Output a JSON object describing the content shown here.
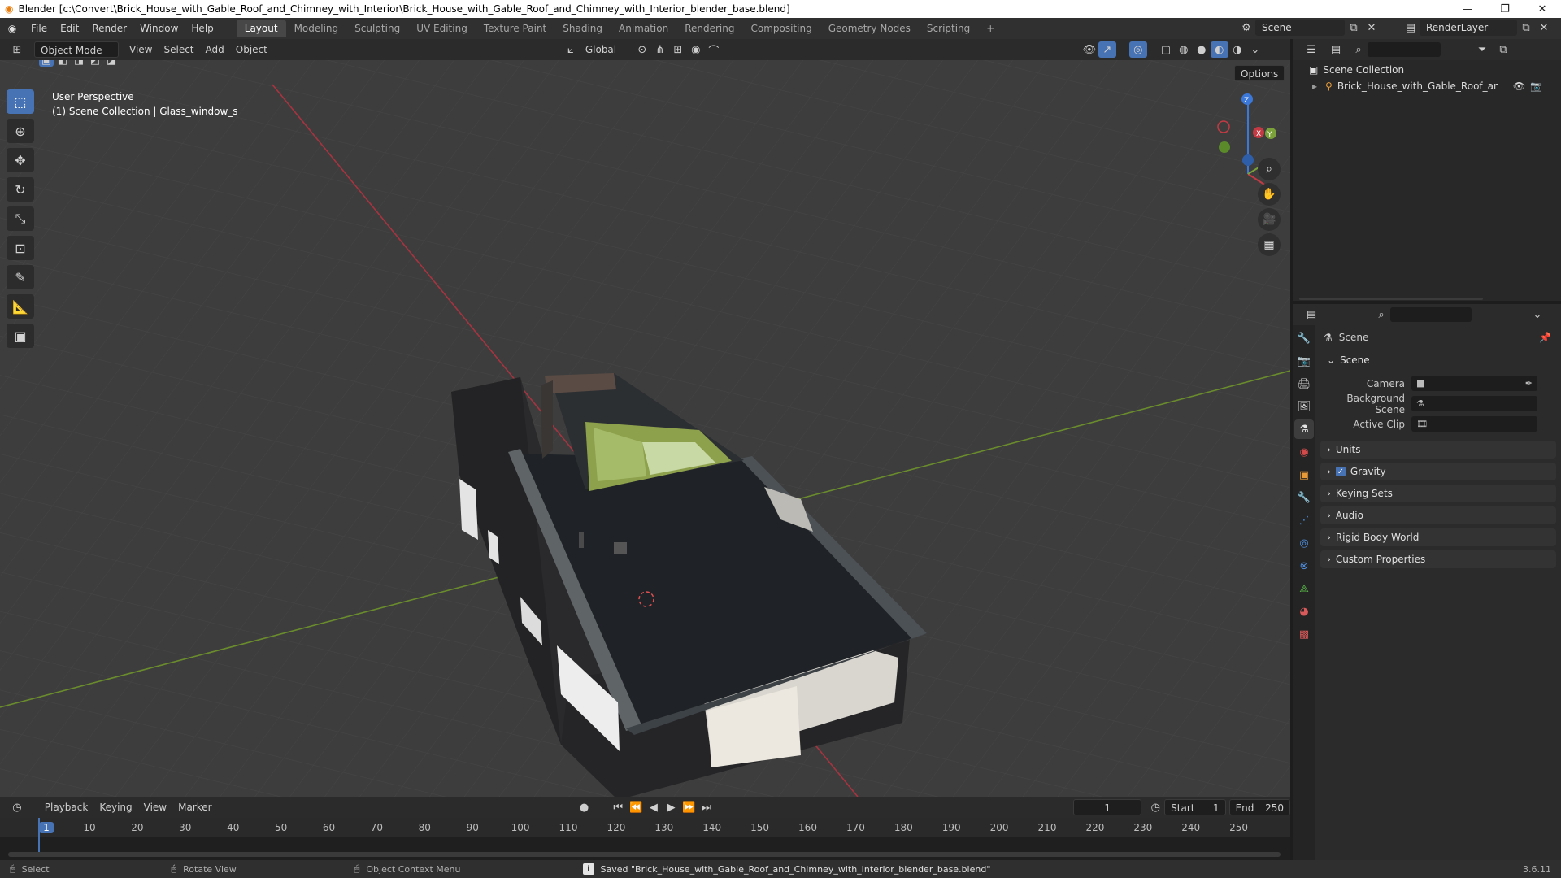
{
  "window": {
    "title": "Blender [c:\\Convert\\Brick_House_with_Gable_Roof_and_Chimney_with_Interior\\Brick_House_with_Gable_Roof_and_Chimney_with_Interior_blender_base.blend]",
    "minimize": "—",
    "maximize": "❐",
    "close": "✕"
  },
  "menu": {
    "items": [
      "File",
      "Edit",
      "Render",
      "Window",
      "Help"
    ],
    "workspaces": [
      "Layout",
      "Modeling",
      "Sculpting",
      "UV Editing",
      "Texture Paint",
      "Shading",
      "Animation",
      "Rendering",
      "Compositing",
      "Geometry Nodes",
      "Scripting"
    ],
    "active_workspace": "Layout",
    "add_tab": "+",
    "scene_name": "Scene",
    "view_layer": "RenderLayer"
  },
  "viewport_header": {
    "mode": "Object Mode",
    "menus": [
      "View",
      "Select",
      "Add",
      "Object"
    ],
    "orientation": "Global",
    "options": "Options"
  },
  "viewport": {
    "perspective": "User Perspective",
    "collection_info": "(1) Scene Collection | Glass_window_s",
    "gizmo_axes": [
      "X",
      "Y",
      "Z"
    ],
    "colors": {
      "x_axis": "#c33a44",
      "y_axis": "#7aa13a",
      "z_axis": "#3b78d8",
      "select": "#4772b3"
    }
  },
  "timeline": {
    "menus": [
      "Playback",
      "Keying",
      "View",
      "Marker"
    ],
    "current_frame": "1",
    "start_label": "Start",
    "start": "1",
    "end_label": "End",
    "end": "250",
    "ticks": [
      "1",
      "10",
      "20",
      "30",
      "40",
      "50",
      "60",
      "70",
      "80",
      "90",
      "100",
      "110",
      "120",
      "130",
      "140",
      "150",
      "160",
      "170",
      "180",
      "190",
      "200",
      "210",
      "220",
      "230",
      "240",
      "250"
    ]
  },
  "outliner": {
    "root": "Scene Collection",
    "items": [
      {
        "label": "Brick_House_with_Gable_Roof_and_Chir"
      }
    ]
  },
  "properties": {
    "header": "Scene",
    "panel_scene": "Scene",
    "fields": [
      {
        "label": "Camera"
      },
      {
        "label": "Background Scene"
      },
      {
        "label": "Active Clip"
      }
    ],
    "panels": [
      "Units",
      "Gravity",
      "Keying Sets",
      "Audio",
      "Rigid Body World",
      "Custom Properties"
    ],
    "gravity_checked": true
  },
  "statusbar": {
    "select": "Select",
    "rotate": "Rotate View",
    "context": "Object Context Menu",
    "message": "Saved \"Brick_House_with_Gable_Roof_and_Chimney_with_Interior_blender_base.blend\"",
    "version": "3.6.11"
  }
}
